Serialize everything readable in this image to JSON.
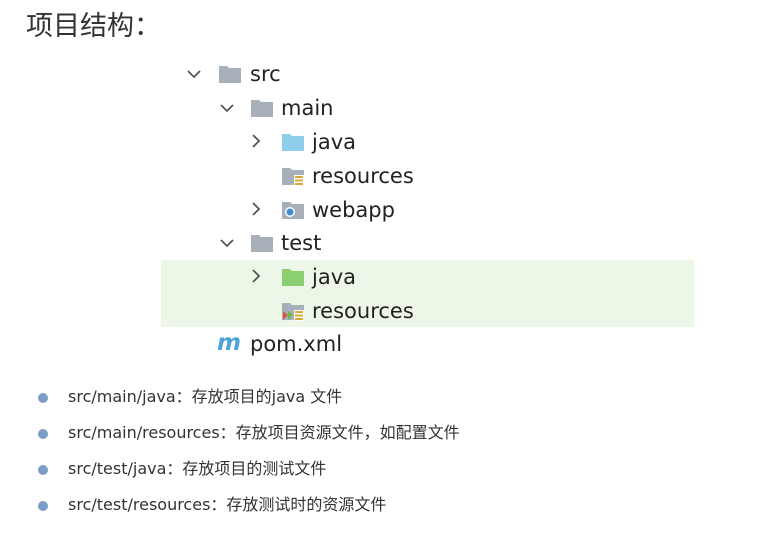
{
  "heading": "项目结构：",
  "tree": {
    "src": "src",
    "main": "main",
    "main_java": "java",
    "main_resources": "resources",
    "main_webapp": "webapp",
    "test": "test",
    "test_java": "java",
    "test_resources": "resources",
    "pom": "pom.xml",
    "pom_icon_letter": "m"
  },
  "bullets": [
    "src/main/java：存放项目的java 文件",
    "src/main/resources：存放项目资源文件，如配置文件",
    "src/test/java：存放项目的测试文件",
    "src/test/resources：存放测试时的资源文件"
  ],
  "colors": {
    "folder_gray": "#a7b0b9",
    "folder_blue": "#8fcdea",
    "folder_green": "#8ccf72",
    "highlight": "#edf7e7",
    "bullet": "#7a9cc6",
    "maven_icon": "#4aa4d9"
  }
}
